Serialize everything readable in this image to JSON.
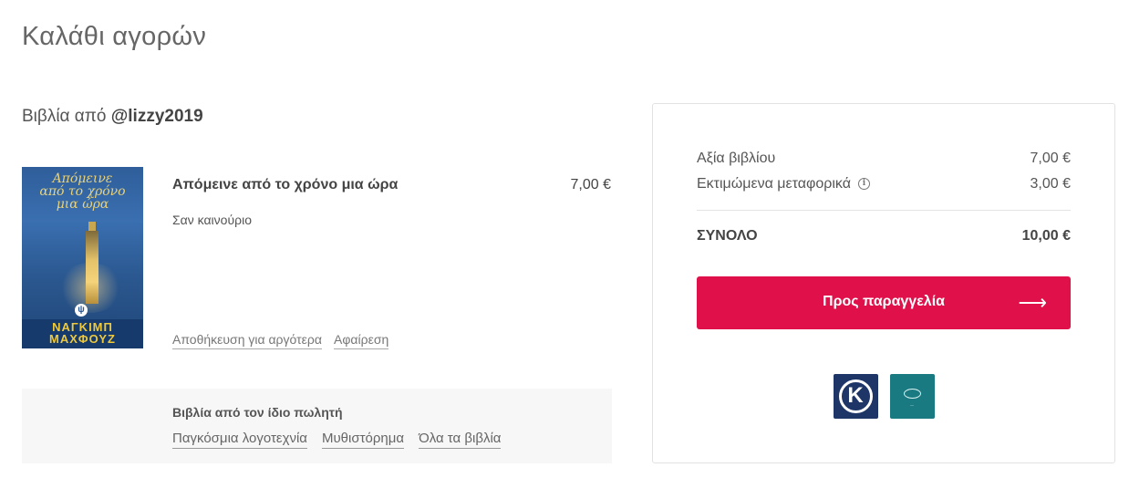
{
  "page": {
    "title": "Καλάθι αγορών"
  },
  "seller": {
    "prefix": "Βιβλία από",
    "handle": "@lizzy2019"
  },
  "book": {
    "cover_title": "Απόμεινε από το χρόνο μια ώρα",
    "cover_author": "ΝΑΓΚΙΜΠ ΜΑΧΦΟΥΖ",
    "title": "Απόμεινε από το χρόνο μια ώρα",
    "price": "7,00 €",
    "condition": "Σαν καινούριο",
    "save_later_label": "Αποθήκευση για αργότερα",
    "remove_label": "Αφαίρεση"
  },
  "same_seller": {
    "title": "Βιβλία από τον ίδιο πωλητή",
    "links": [
      "Παγκόσμια λογοτεχνία",
      "Μυθιστόρημα",
      "Όλα τα βιβλία"
    ]
  },
  "summary": {
    "book_value_label": "Αξία βιβλίου",
    "book_value": "7,00 €",
    "shipping_label": "Εκτιμώμενα μεταφορικά",
    "shipping_value": "3,00 €",
    "total_label": "ΣΥΝΟΛΟ",
    "total_value": "10,00 €",
    "order_button_label": "Προς παραγγελία"
  },
  "icons": {
    "info": "info-icon",
    "arrow": "arrow-right-icon"
  },
  "colors": {
    "accent": "#e0104a",
    "alpha_bank": "#1d3567",
    "nbg": "#1a7a82"
  }
}
